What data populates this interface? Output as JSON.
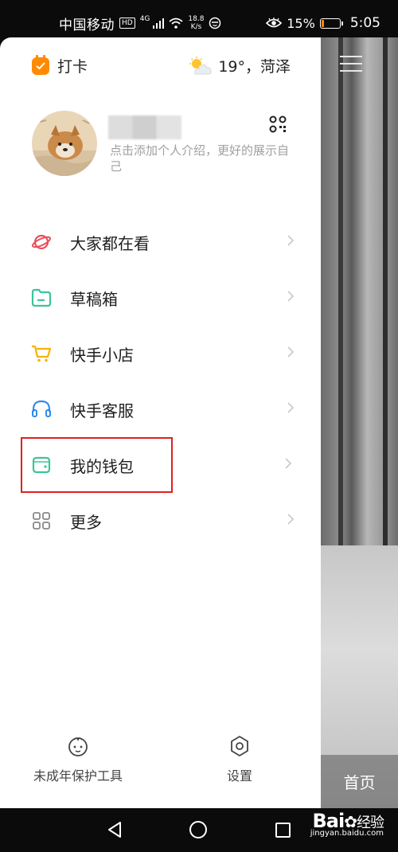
{
  "status_bar": {
    "carrier": "中国移动",
    "hd": "HD",
    "network": "4G",
    "speed_top": "18.8",
    "speed_unit": "K/s",
    "battery": "15%",
    "time": "5:05"
  },
  "header": {
    "checkin_label": "打卡",
    "weather_text": "19°，菏泽"
  },
  "profile": {
    "bio": "点击添加个人介绍，更好的展示自己"
  },
  "menu": [
    {
      "label": "大家都在看",
      "icon": "planet-icon",
      "color": "#e8505b"
    },
    {
      "label": "草稿箱",
      "icon": "folder-icon",
      "color": "#3cc59a"
    },
    {
      "label": "快手小店",
      "icon": "cart-icon",
      "color": "#f5b400"
    },
    {
      "label": "快手客服",
      "icon": "headset-icon",
      "color": "#2f8ce8"
    },
    {
      "label": "我的钱包",
      "icon": "wallet-icon",
      "color": "#3cc59a"
    },
    {
      "label": "更多",
      "icon": "grid-icon",
      "color": "#888888"
    }
  ],
  "bottom_tools": {
    "minor_protection": "未成年保护工具",
    "settings": "设置"
  },
  "feed": {
    "home_tab": "首页"
  },
  "watermark": {
    "logo": "Bai",
    "logo_suffix": "经验",
    "url": "jingyan.baidu.com"
  },
  "colors": {
    "accent": "#ff8a00",
    "highlight_box": "#e02020"
  }
}
